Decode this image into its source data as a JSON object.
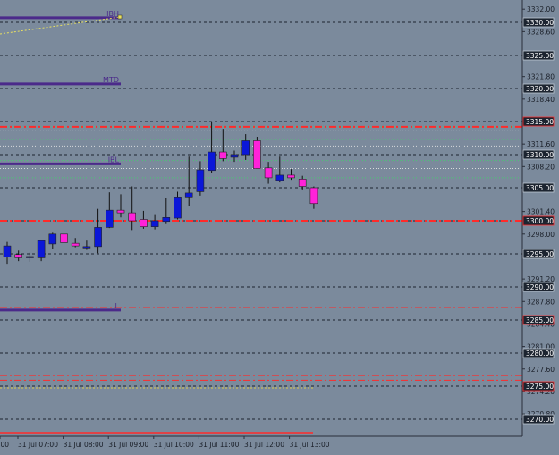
{
  "chart_data": {
    "type": "candlestick",
    "y_ticks": [
      "3332.00",
      "3328.60",
      "3325.00",
      "3321.80",
      "3318.40",
      "3315.00",
      "3311.60",
      "3308.20",
      "3305.00",
      "3301.40",
      "3298.00",
      "3295.00",
      "3291.20",
      "3290.00",
      "3287.80",
      "3284.40",
      "3281.00",
      "3280.00",
      "3277.60",
      "3274.20",
      "3270.80",
      "3270.00"
    ],
    "x_labels": [
      ":00",
      "31 Jul 07:00",
      "31 Jul 08:00",
      "31 Jul 09:00",
      "31 Jul 10:00",
      "31 Jul 11:00",
      "31 Jul 12:00",
      "31 Jul 13:00"
    ],
    "price_boxes": [
      "3330.00",
      "3325.00",
      "3320.00",
      "3315.00",
      "3310.00",
      "3305.00",
      "3300.00",
      "3295.00",
      "3290.00",
      "3285.00",
      "3280.00",
      "3275.00",
      "3270.00"
    ],
    "level_labels": [
      "IBH",
      "MTD",
      "IBL",
      "L"
    ],
    "levels": {
      "IBH": 3330.7,
      "MTD": 3320.7,
      "IBL": 3308.6,
      "L": 3286.5
    },
    "resistance_lines": [
      3314.2,
      3313.6,
      3312.3,
      3311.3,
      3309.1,
      3307.9,
      3306.5
    ],
    "red_lines": [
      3314.2,
      3300.0,
      3286.9,
      3276.6,
      3275.9
    ],
    "candles": [
      {
        "o": 3294.5,
        "h": 3296.8,
        "l": 3293.5,
        "c": 3296.2
      },
      {
        "o": 3294.9,
        "h": 3295.5,
        "l": 3293.9,
        "c": 3294.4
      },
      {
        "o": 3294.4,
        "h": 3295.2,
        "l": 3293.8,
        "c": 3294.6
      },
      {
        "o": 3294.4,
        "h": 3297.1,
        "l": 3293.9,
        "c": 3297.0
      },
      {
        "o": 3296.5,
        "h": 3298.2,
        "l": 3295.8,
        "c": 3298.0
      },
      {
        "o": 3298.0,
        "h": 3298.6,
        "l": 3296.2,
        "c": 3296.7
      },
      {
        "o": 3296.6,
        "h": 3297.4,
        "l": 3296.0,
        "c": 3296.2
      },
      {
        "o": 3296.0,
        "h": 3297.0,
        "l": 3295.6,
        "c": 3296.1
      },
      {
        "o": 3296.1,
        "h": 3301.8,
        "l": 3295.1,
        "c": 3299.0
      },
      {
        "o": 3299.0,
        "h": 3304.3,
        "l": 3298.9,
        "c": 3301.6
      },
      {
        "o": 3301.6,
        "h": 3304.0,
        "l": 3300.5,
        "c": 3301.2
      },
      {
        "o": 3301.2,
        "h": 3305.2,
        "l": 3298.6,
        "c": 3300.0
      },
      {
        "o": 3300.2,
        "h": 3301.5,
        "l": 3298.8,
        "c": 3299.1
      },
      {
        "o": 3299.1,
        "h": 3301.0,
        "l": 3298.7,
        "c": 3300.0
      },
      {
        "o": 3299.9,
        "h": 3303.5,
        "l": 3299.5,
        "c": 3300.5
      },
      {
        "o": 3300.4,
        "h": 3304.4,
        "l": 3300.2,
        "c": 3303.6
      },
      {
        "o": 3303.6,
        "h": 3309.7,
        "l": 3302.2,
        "c": 3304.2
      },
      {
        "o": 3304.4,
        "h": 3309.0,
        "l": 3303.8,
        "c": 3307.7
      },
      {
        "o": 3307.6,
        "h": 3315.0,
        "l": 3307.2,
        "c": 3310.4
      },
      {
        "o": 3310.4,
        "h": 3313.9,
        "l": 3309.0,
        "c": 3309.4
      },
      {
        "o": 3309.6,
        "h": 3310.6,
        "l": 3308.9,
        "c": 3310.0
      },
      {
        "o": 3310.0,
        "h": 3313.1,
        "l": 3309.2,
        "c": 3312.1
      },
      {
        "o": 3312.1,
        "h": 3312.7,
        "l": 3307.9,
        "c": 3307.9
      },
      {
        "o": 3308.0,
        "h": 3308.9,
        "l": 3305.6,
        "c": 3306.5
      },
      {
        "o": 3306.1,
        "h": 3309.7,
        "l": 3305.8,
        "c": 3306.9
      },
      {
        "o": 3306.9,
        "h": 3307.8,
        "l": 3306.2,
        "c": 3306.5
      },
      {
        "o": 3306.3,
        "h": 3306.8,
        "l": 3304.6,
        "c": 3305.2
      },
      {
        "o": 3305.0,
        "h": 3305.2,
        "l": 3301.8,
        "c": 3302.6
      }
    ],
    "colors": {
      "background": "#7b8a9c",
      "grid": "#1e2430",
      "bull": "#0b17d8",
      "bear": "#ff22d9",
      "wick": "#101010",
      "level": "#4b2a8a",
      "red": "#ff2a2a",
      "green": "#41d36b",
      "axis": "#2a2f3a",
      "label_box": "#1c2430"
    }
  }
}
